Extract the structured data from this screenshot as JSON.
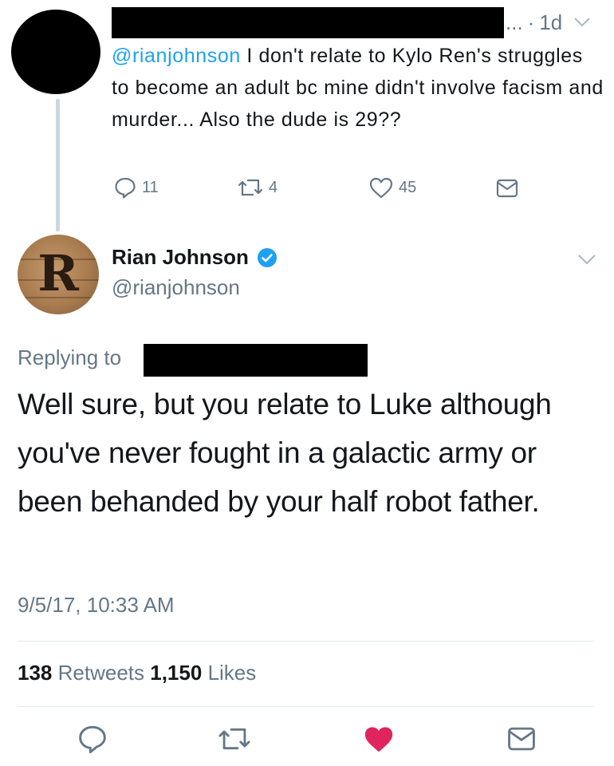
{
  "parent_tweet": {
    "meta_ellipsis": "...",
    "time_separator": "·",
    "time_ago": "1d",
    "mention": "@rianjohnson",
    "text": " I don't relate to Kylo Ren's struggles to become an adult bc mine didn't involve facism and murder... Also the dude is 29??",
    "replies_count": "11",
    "retweets_count": "4",
    "likes_count": "45"
  },
  "reply_tweet": {
    "author_name": "Rian Johnson",
    "author_handle": "@rianjohnson",
    "avatar_letter": "R",
    "replying_to_label": "Replying to",
    "text": "Well sure, but you relate to Luke although you've never fought in a galactic army or been behanded by your half robot father.",
    "timestamp": "9/5/17, 10:33 AM",
    "retweets_count": "138",
    "retweets_label": "Retweets",
    "likes_count": "1,150",
    "likes_label": "Likes",
    "liked": true
  },
  "colors": {
    "link_blue": "#1da1f2",
    "muted_gray": "#657786",
    "like_red": "#e0245e",
    "thread_line": "#ccd6dd"
  },
  "icons": [
    "reply-icon",
    "retweet-icon",
    "heart-icon",
    "direct-message-icon",
    "chevron-down-icon",
    "verified-badge-icon"
  ]
}
